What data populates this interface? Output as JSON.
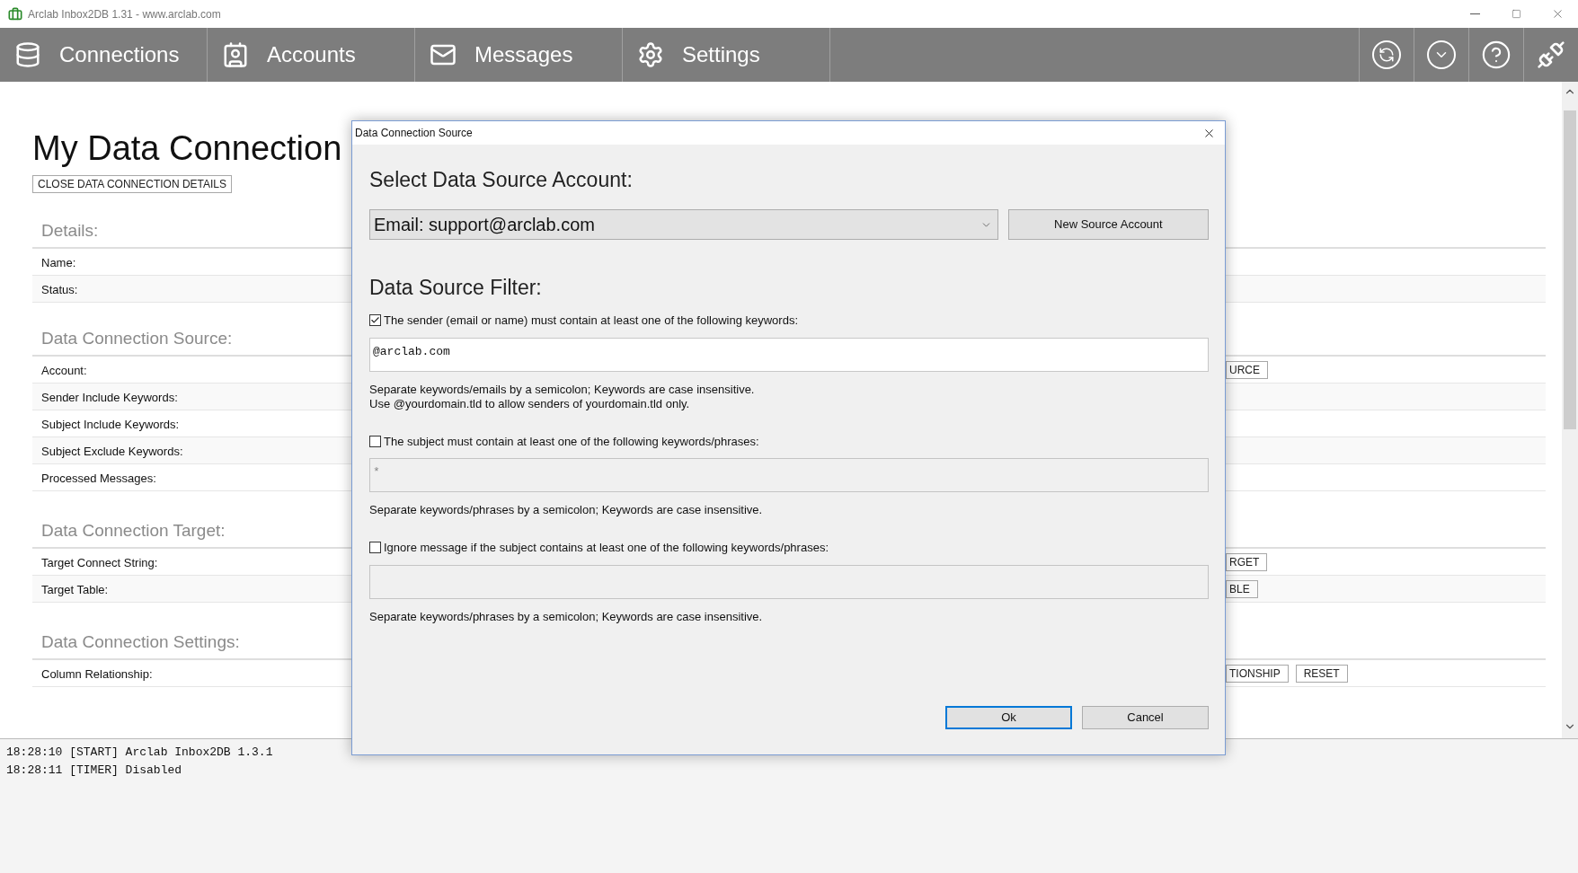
{
  "window": {
    "title": "Arclab Inbox2DB 1.31 - www.arclab.com"
  },
  "nav": {
    "tabs": [
      {
        "label": "Connections"
      },
      {
        "label": "Accounts"
      },
      {
        "label": "Messages"
      },
      {
        "label": "Settings"
      }
    ]
  },
  "page": {
    "title": "My Data Connection",
    "close_button": "CLOSE DATA CONNECTION DETAILS",
    "sections": [
      {
        "heading": "Details:",
        "rows": [
          {
            "label": "Name:"
          },
          {
            "label": "Status:"
          }
        ]
      },
      {
        "heading": "Data Connection Source:",
        "rows": [
          {
            "label": "Account:",
            "buttons": [
              "URCE"
            ]
          },
          {
            "label": "Sender Include Keywords:"
          },
          {
            "label": "Subject Include Keywords:"
          },
          {
            "label": "Subject Exclude Keywords:"
          },
          {
            "label": "Processed Messages:"
          }
        ]
      },
      {
        "heading": "Data Connection Target:",
        "rows": [
          {
            "label": "Target Connect String:",
            "buttons": [
              "RGET"
            ]
          },
          {
            "label": "Target Table:",
            "buttons": [
              "BLE"
            ]
          }
        ]
      },
      {
        "heading": "Data Connection Settings:",
        "rows": [
          {
            "label": "Column Relationship:",
            "buttons": [
              "TIONSHIP",
              "RESET"
            ]
          }
        ]
      }
    ]
  },
  "dialog": {
    "title": "Data Connection Source",
    "account_heading": "Select Data Source Account:",
    "account_select": {
      "value": "Email: support@arclab.com"
    },
    "new_account_button": "New Source Account",
    "filter_heading": "Data Source Filter:",
    "filters": [
      {
        "label": "The sender (email or name) must contain at least one of the following keywords:",
        "checked": true,
        "value": "@arclab.com",
        "help": [
          "Separate keywords/emails by a semicolon; Keywords are case insensitive.",
          "Use @yourdomain.tld to allow senders of yourdomain.tld only."
        ]
      },
      {
        "label": "The subject must contain at least one of the following keywords/phrases:",
        "checked": false,
        "placeholder": "*",
        "help": [
          "Separate keywords/phrases by a semicolon; Keywords are case insensitive."
        ]
      },
      {
        "label": "Ignore message if the subject contains at least one of the following keywords/phrases:",
        "checked": false,
        "help": [
          "Separate keywords/phrases by a semicolon; Keywords are case insensitive."
        ]
      }
    ],
    "buttons": [
      {
        "label": "Ok",
        "focused": true
      },
      {
        "label": "Cancel",
        "focused": false
      }
    ]
  },
  "log": [
    "18:28:10 [START] Arclab Inbox2DB 1.3.1",
    "18:28:11 [TIMER] Disabled"
  ]
}
